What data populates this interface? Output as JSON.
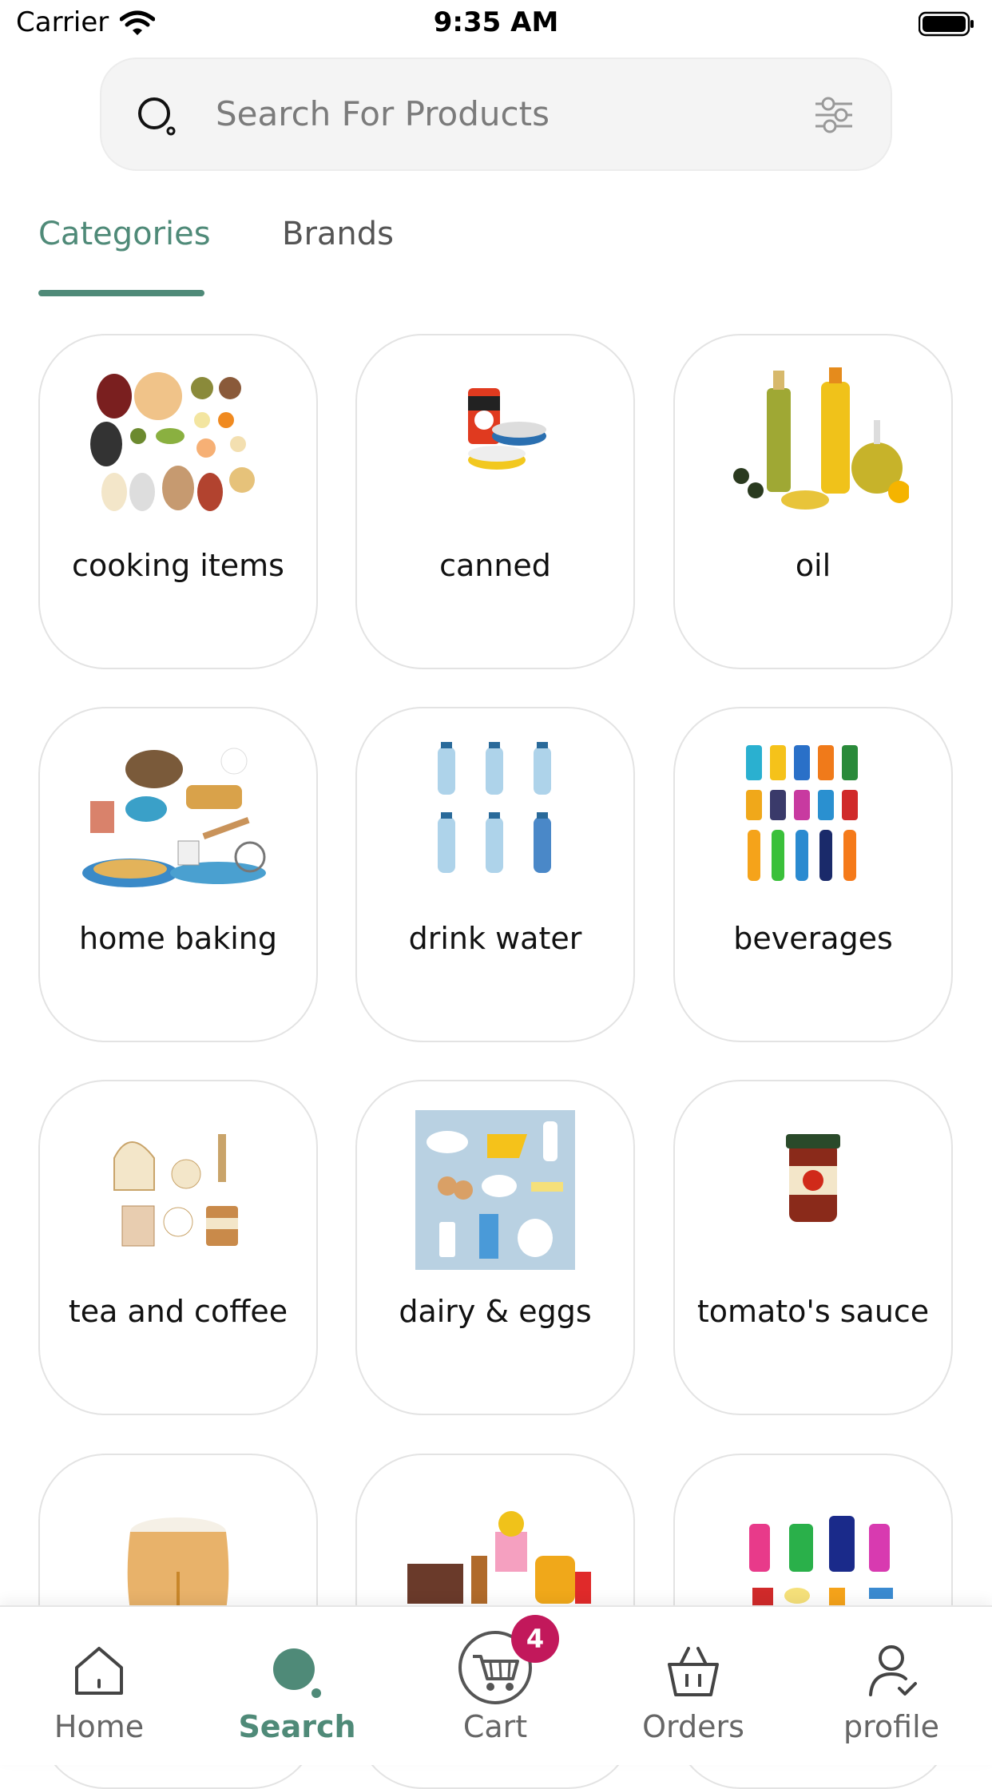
{
  "status_bar": {
    "carrier": "Carrier",
    "time": "9:35 AM"
  },
  "search": {
    "placeholder": "Search For Products"
  },
  "tabs": [
    {
      "label": "Categories",
      "active": true
    },
    {
      "label": "Brands",
      "active": false
    }
  ],
  "categories": [
    {
      "label": "cooking items",
      "icon": "legumes-image"
    },
    {
      "label": "canned",
      "icon": "canned-food-image"
    },
    {
      "label": "oil",
      "icon": "oil-bottles-image"
    },
    {
      "label": "home baking",
      "icon": "baking-illustration-image"
    },
    {
      "label": "drink water",
      "icon": "water-bottles-image"
    },
    {
      "label": "beverages",
      "icon": "soda-cans-image"
    },
    {
      "label": "tea and coffee",
      "icon": "tea-set-image"
    },
    {
      "label": "dairy & eggs",
      "icon": "dairy-products-image"
    },
    {
      "label": "tomato's sauce",
      "icon": "tomato-sauce-jar-image"
    },
    {
      "label": "",
      "icon": "rice-sack-image"
    },
    {
      "label": "",
      "icon": "sweets-image"
    },
    {
      "label": "",
      "icon": "cleaning-products-image"
    }
  ],
  "bottom_nav": {
    "items": [
      {
        "label": "Home",
        "icon": "home-icon",
        "active": false
      },
      {
        "label": "Search",
        "icon": "search-icon",
        "active": true
      },
      {
        "label": "Cart",
        "icon": "cart-icon",
        "active": false,
        "badge": "4"
      },
      {
        "label": "Orders",
        "icon": "basket-icon",
        "active": false
      },
      {
        "label": "profile",
        "icon": "profile-icon",
        "active": false
      }
    ]
  },
  "colors": {
    "accent": "#4f8a78",
    "badge": "#c2185b"
  }
}
